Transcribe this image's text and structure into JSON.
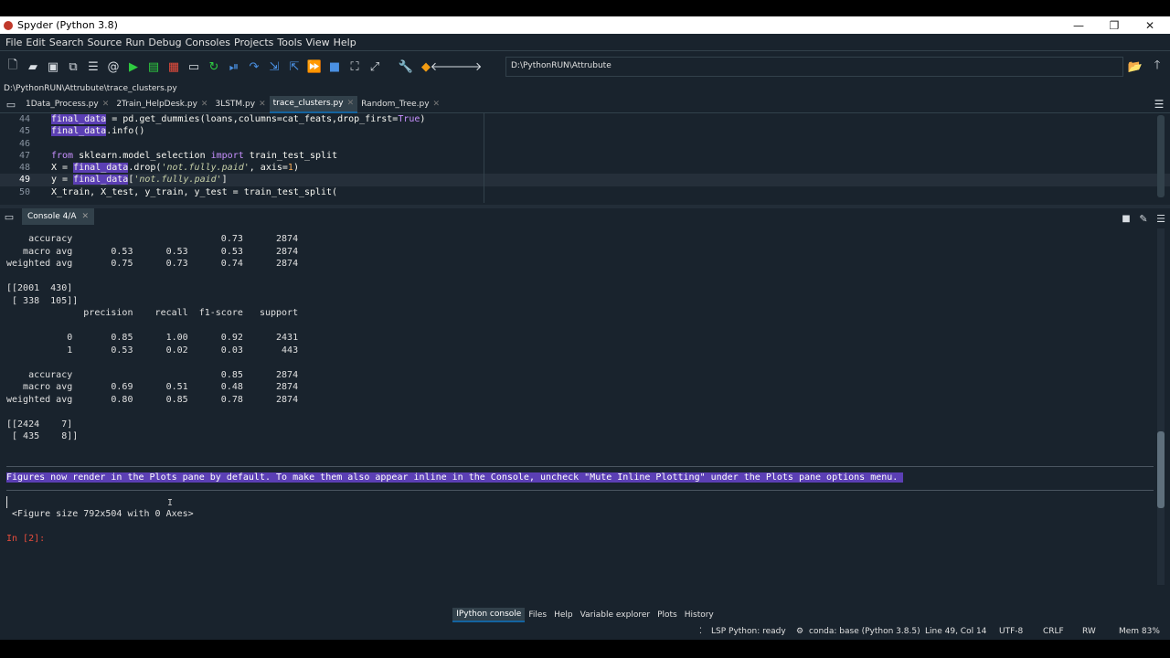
{
  "window": {
    "title": "Spyder (Python 3.8)",
    "controls": {
      "minimize": "—",
      "restore": "❐",
      "close": "✕"
    }
  },
  "menu": [
    "File",
    "Edit",
    "Search",
    "Source",
    "Run",
    "Debug",
    "Consoles",
    "Projects",
    "Tools",
    "View",
    "Help"
  ],
  "toolbar": {
    "path": "D:\\PythonRUN\\Attrubute"
  },
  "file_path": "D:\\PythonRUN\\Attrubute\\trace_clusters.py",
  "editor": {
    "tabs": [
      {
        "label": "1Data_Process.py",
        "active": false
      },
      {
        "label": "2Train_HelpDesk.py",
        "active": false
      },
      {
        "label": "3LSTM.py",
        "active": false
      },
      {
        "label": "trace_clusters.py",
        "active": true
      },
      {
        "label": "Random_Tree.py",
        "active": false
      }
    ],
    "line_numbers": [
      "44",
      "45",
      "46",
      "47",
      "48",
      "49",
      "50"
    ],
    "current_line": "49"
  },
  "console": {
    "tab_label": "Console 4/A",
    "lines": [
      "    accuracy                           0.73      2874",
      "   macro avg       0.53      0.53      0.53      2874",
      "weighted avg       0.75      0.73      0.74      2874",
      "",
      "[[2001  430]",
      " [ 338  105]]",
      "              precision    recall  f1-score   support",
      "",
      "           0       0.85      1.00      0.92      2431",
      "           1       0.53      0.02      0.03       443",
      "",
      "    accuracy                           0.85      2874",
      "   macro avg       0.69      0.51      0.48      2874",
      "weighted avg       0.80      0.85      0.78      2874",
      "",
      "[[2424    7]",
      " [ 435    8]]"
    ],
    "notice": "Figures now render in the Plots pane by default. To make them also appear inline in the Console, uncheck \"Mute Inline Plotting\" under the Plots pane options menu. ",
    "figure_output": " <Figure size 792x504 with 0 Axes>",
    "prompt": "In [2]:"
  },
  "pane_tabs": [
    {
      "label": "IPython console",
      "active": true
    },
    {
      "label": "Files",
      "active": false
    },
    {
      "label": "Help",
      "active": false
    },
    {
      "label": "Variable explorer",
      "active": false
    },
    {
      "label": "Plots",
      "active": false
    },
    {
      "label": "History",
      "active": false
    }
  ],
  "status": {
    "lsp": "LSP Python: ready",
    "conda": "conda: base (Python 3.8.5)",
    "position": "Line 49, Col 14",
    "encoding": "UTF-8",
    "eol": "CRLF",
    "rw": "RW",
    "mem": "Mem 83%"
  },
  "colors": {
    "background": "#19232d",
    "selection": "#5b3fb4",
    "accent": "#1464a0"
  }
}
